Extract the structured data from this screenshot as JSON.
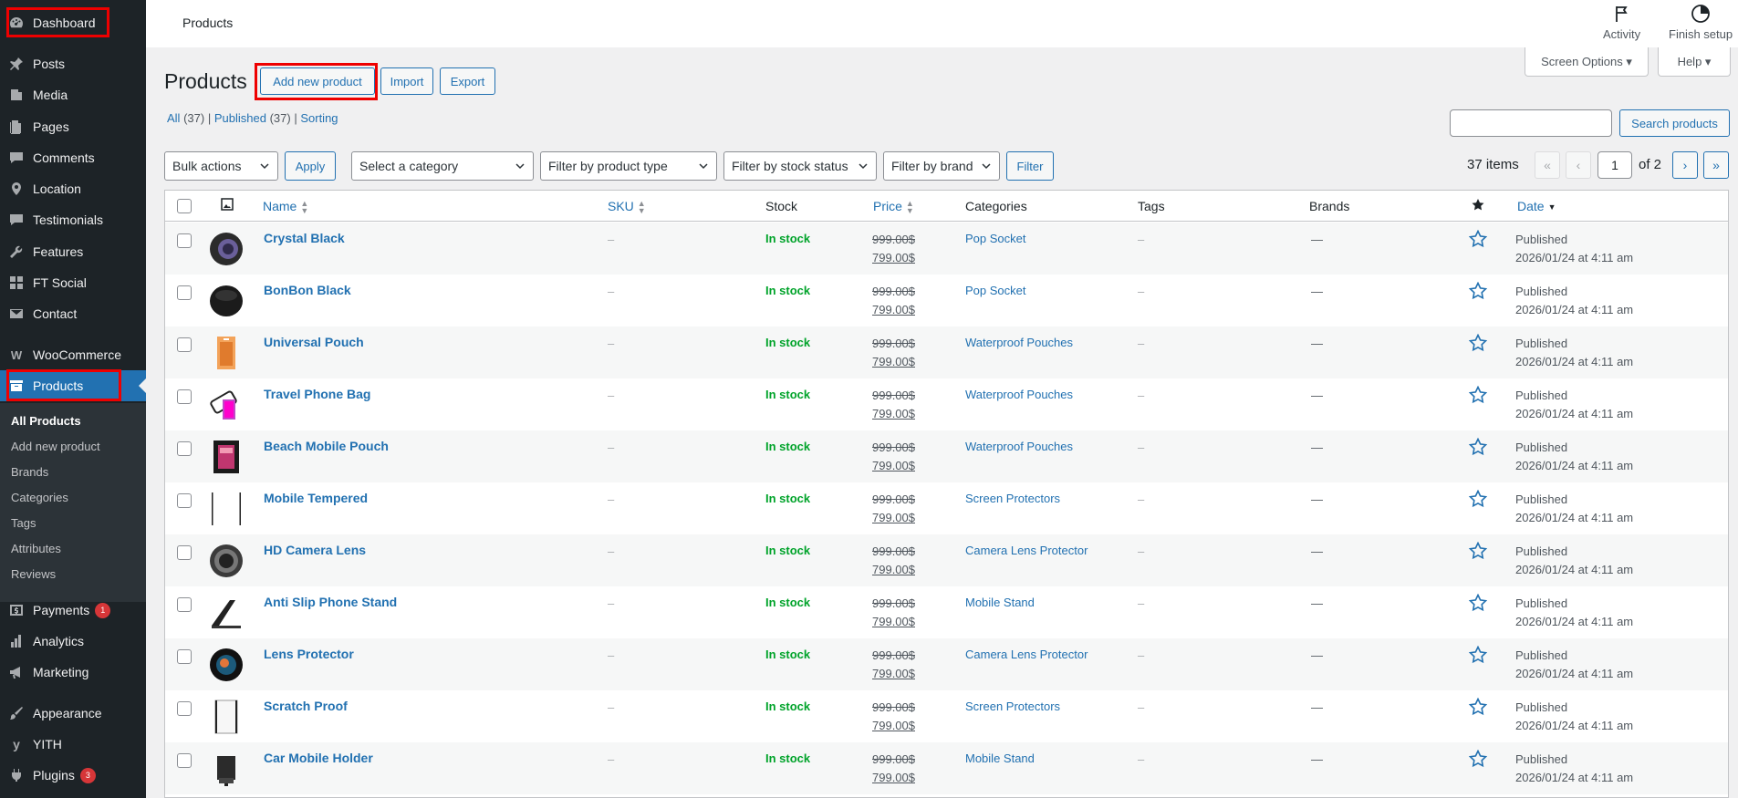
{
  "sidebar": {
    "items": [
      {
        "label": "Dashboard",
        "icon": "dashboard-icon"
      },
      {
        "label": "Posts",
        "icon": "pin-icon"
      },
      {
        "label": "Media",
        "icon": "media-icon"
      },
      {
        "label": "Pages",
        "icon": "pages-icon"
      },
      {
        "label": "Comments",
        "icon": "comment-icon"
      },
      {
        "label": "Location",
        "icon": "location-icon"
      },
      {
        "label": "Testimonials",
        "icon": "testimonial-icon"
      },
      {
        "label": "Features",
        "icon": "wrench-icon"
      },
      {
        "label": "FT Social",
        "icon": "social-icon"
      },
      {
        "label": "Contact",
        "icon": "mail-icon"
      },
      {
        "label": "WooCommerce",
        "icon": "woo-icon"
      },
      {
        "label": "Products",
        "icon": "archive-icon"
      },
      {
        "label": "Payments",
        "icon": "dollar-icon",
        "badge": "1"
      },
      {
        "label": "Analytics",
        "icon": "chart-icon"
      },
      {
        "label": "Marketing",
        "icon": "megaphone-icon"
      },
      {
        "label": "Appearance",
        "icon": "brush-icon"
      },
      {
        "label": "YITH",
        "icon": "yith-icon"
      },
      {
        "label": "Plugins",
        "icon": "plug-icon",
        "badge": "3"
      }
    ],
    "submenu": [
      "All Products",
      "Add new product",
      "Brands",
      "Categories",
      "Tags",
      "Attributes",
      "Reviews"
    ]
  },
  "topbar": {
    "title": "Products",
    "activity": "Activity",
    "finish_setup": "Finish setup"
  },
  "screen_options": "Screen Options ▾",
  "help": "Help ▾",
  "heading": "Products",
  "actions": {
    "add_new": "Add new product",
    "import": "Import",
    "export": "Export"
  },
  "views": {
    "all": "All",
    "all_count": "(37)",
    "published": "Published",
    "published_count": "(37)",
    "sorting": "Sorting",
    "sep": "|"
  },
  "search_button": "Search products",
  "filters": {
    "bulk": "Bulk actions",
    "apply": "Apply",
    "category": "Select a category",
    "type": "Filter by product type",
    "stock": "Filter by stock status",
    "brand": "Filter by brand",
    "filter": "Filter"
  },
  "pagination": {
    "items": "37 items",
    "first": "«",
    "prev": "‹",
    "page": "1",
    "of": "of 2",
    "next": "›",
    "last": "»"
  },
  "columns": {
    "name": "Name",
    "sku": "SKU",
    "stock": "Stock",
    "price": "Price",
    "categories": "Categories",
    "tags": "Tags",
    "brands": "Brands",
    "date": "Date"
  },
  "accent": "#2271b1",
  "rows": [
    {
      "name": "Crystal Black",
      "sku": "–",
      "stock": "In stock",
      "old_price": "999.00$",
      "price": "799.00$",
      "category": "Pop Socket",
      "tags": "–",
      "brands": "—",
      "status": "Published",
      "date": "2026/01/24 at 4:11 am"
    },
    {
      "name": "BonBon Black",
      "sku": "–",
      "stock": "In stock",
      "old_price": "999.00$",
      "price": "799.00$",
      "category": "Pop Socket",
      "tags": "–",
      "brands": "—",
      "status": "Published",
      "date": "2026/01/24 at 4:11 am"
    },
    {
      "name": "Universal Pouch",
      "sku": "–",
      "stock": "In stock",
      "old_price": "999.00$",
      "price": "799.00$",
      "category": "Waterproof Pouches",
      "tags": "–",
      "brands": "—",
      "status": "Published",
      "date": "2026/01/24 at 4:11 am"
    },
    {
      "name": "Travel Phone Bag",
      "sku": "–",
      "stock": "In stock",
      "old_price": "999.00$",
      "price": "799.00$",
      "category": "Waterproof Pouches",
      "tags": "–",
      "brands": "—",
      "status": "Published",
      "date": "2026/01/24 at 4:11 am"
    },
    {
      "name": "Beach Mobile Pouch",
      "sku": "–",
      "stock": "In stock",
      "old_price": "999.00$",
      "price": "799.00$",
      "category": "Waterproof Pouches",
      "tags": "–",
      "brands": "—",
      "status": "Published",
      "date": "2026/01/24 at 4:11 am"
    },
    {
      "name": "Mobile Tempered",
      "sku": "–",
      "stock": "In stock",
      "old_price": "999.00$",
      "price": "799.00$",
      "category": "Screen Protectors",
      "tags": "–",
      "brands": "—",
      "status": "Published",
      "date": "2026/01/24 at 4:11 am"
    },
    {
      "name": "HD Camera Lens",
      "sku": "–",
      "stock": "In stock",
      "old_price": "999.00$",
      "price": "799.00$",
      "category": "Camera Lens Protector",
      "tags": "–",
      "brands": "—",
      "status": "Published",
      "date": "2026/01/24 at 4:11 am"
    },
    {
      "name": "Anti Slip Phone Stand",
      "sku": "–",
      "stock": "In stock",
      "old_price": "999.00$",
      "price": "799.00$",
      "category": "Mobile Stand",
      "tags": "–",
      "brands": "—",
      "status": "Published",
      "date": "2026/01/24 at 4:11 am"
    },
    {
      "name": "Lens Protector",
      "sku": "–",
      "stock": "In stock",
      "old_price": "999.00$",
      "price": "799.00$",
      "category": "Camera Lens Protector",
      "tags": "–",
      "brands": "—",
      "status": "Published",
      "date": "2026/01/24 at 4:11 am"
    },
    {
      "name": "Scratch Proof",
      "sku": "–",
      "stock": "In stock",
      "old_price": "999.00$",
      "price": "799.00$",
      "category": "Screen Protectors",
      "tags": "–",
      "brands": "—",
      "status": "Published",
      "date": "2026/01/24 at 4:11 am"
    },
    {
      "name": "Car Mobile Holder",
      "sku": "–",
      "stock": "In stock",
      "old_price": "999.00$",
      "price": "799.00$",
      "category": "Mobile Stand",
      "tags": "–",
      "brands": "—",
      "status": "Published",
      "date": "2026/01/24 at 4:11 am"
    }
  ]
}
